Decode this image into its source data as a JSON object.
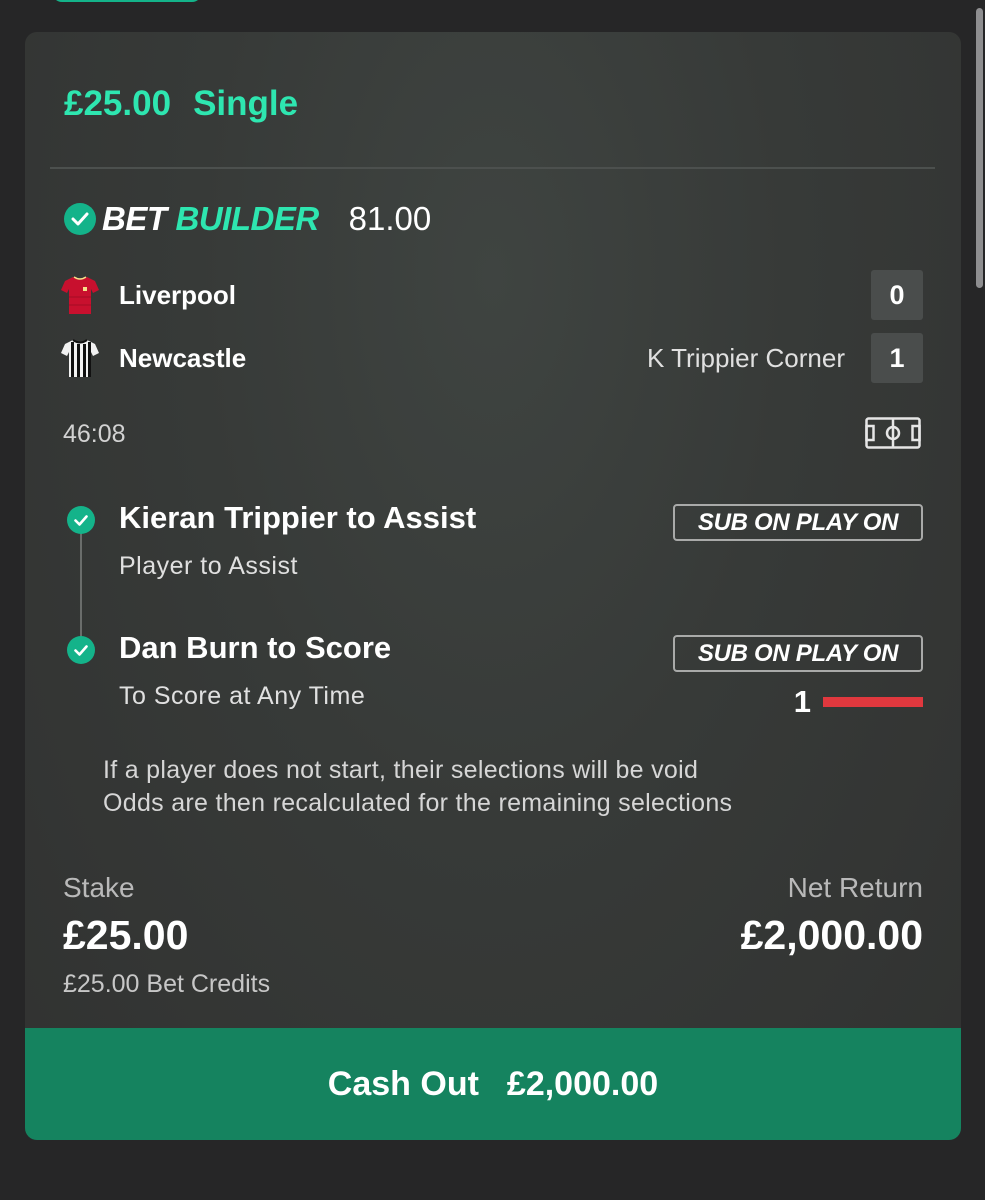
{
  "bet": {
    "amount": "£25.00",
    "type": "Single"
  },
  "bet_builder": {
    "label_part1": "BET",
    "label_part2": "BUILDER",
    "odds": "81.00"
  },
  "match": {
    "home_team": "Liverpool",
    "away_team": "Newcastle",
    "home_score": "0",
    "away_score": "1",
    "latest_event": "K Trippier Corner",
    "clock": "46:08",
    "home_shirt_color": "#c8102e",
    "away_shirt_color": "#111111"
  },
  "selections": [
    {
      "title": "Kieran Trippier to Assist",
      "market": "Player to Assist",
      "badge": "SUB ON PLAY ON"
    },
    {
      "title": "Dan Burn to Score",
      "market": "To Score at Any Time",
      "badge": "SUB ON PLAY ON",
      "progress_label": "1"
    }
  ],
  "notice": {
    "line1": "If a player does not start, their selections will be void",
    "line2": "Odds are then recalculated for the remaining selections"
  },
  "stake": {
    "label": "Stake",
    "value": "£25.00",
    "credits": "£25.00 Bet Credits"
  },
  "net_return": {
    "label": "Net Return",
    "value": "£2,000.00"
  },
  "cash_out": {
    "label": "Cash Out",
    "value": "£2,000.00"
  },
  "colors": {
    "accent": "#2ee6b0",
    "check_green": "#14b38a",
    "cash_out_bg": "#15835f",
    "progress_red": "#e0383e",
    "card_bg": "#373a38"
  }
}
